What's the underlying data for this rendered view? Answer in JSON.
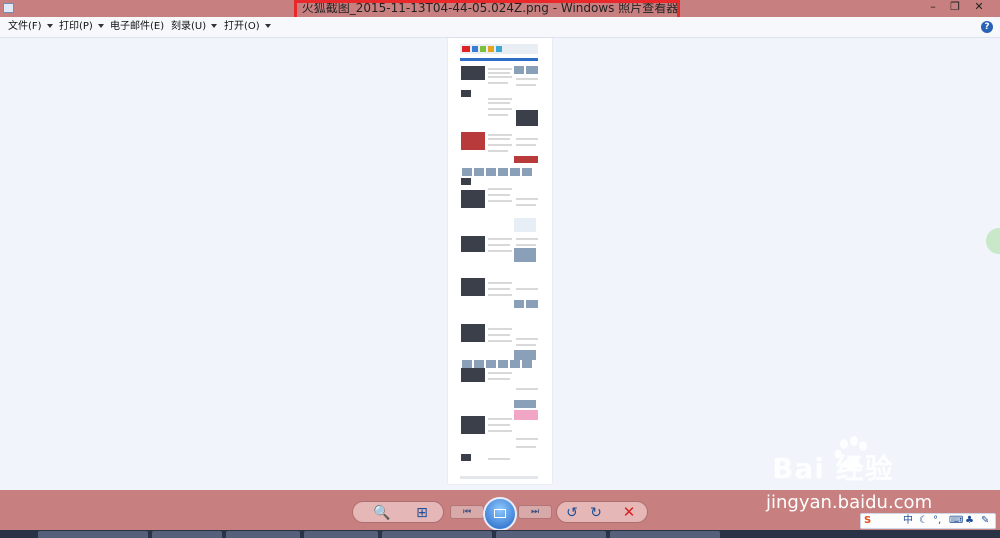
{
  "window": {
    "title": "火狐截图_2015-11-13T04-44-05.024Z.png - Windows 照片查看器",
    "min_label": "–",
    "max_label": "❐",
    "close_label": "✕"
  },
  "menu": {
    "items": [
      {
        "label": "文件(F)"
      },
      {
        "label": "打印(P)"
      },
      {
        "label": "电子邮件(E)"
      },
      {
        "label": "刻录(U)"
      },
      {
        "label": "打开(O)"
      }
    ],
    "help_label": "?"
  },
  "controls": {
    "zoom_icon": "zoom-icon",
    "fit_icon": "fit-window-icon",
    "prev_label": "⏮",
    "next_label": "⏭",
    "rotate_ccw_label": "↺",
    "rotate_cw_label": "↻",
    "delete_label": "✕"
  },
  "watermark": {
    "logo_text": "Bai 经验",
    "url": "jingyan.baidu.com"
  },
  "ime": {
    "lang_label": "中"
  },
  "colors": {
    "chrome": "#c77f7f",
    "annotation": "#e8282a",
    "accent": "#1f63c4"
  }
}
